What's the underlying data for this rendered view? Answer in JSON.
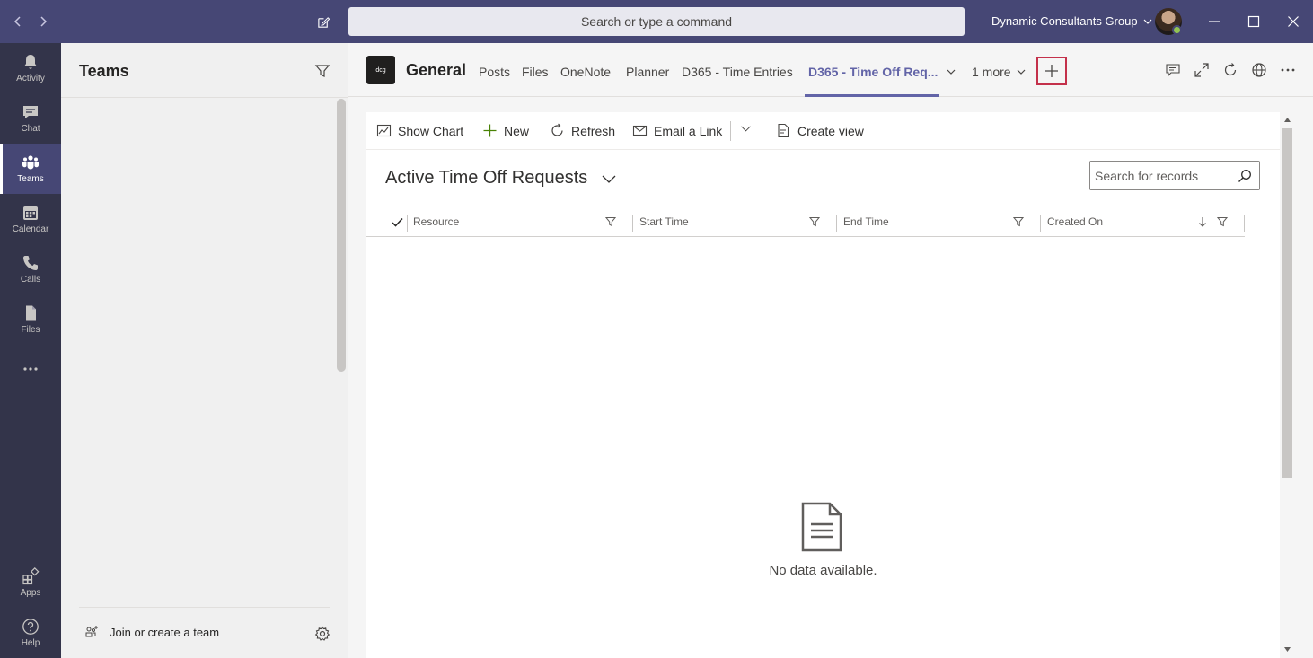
{
  "titlebar": {
    "search_placeholder": "Search or type a command",
    "org_name": "Dynamic Consultants Group"
  },
  "rail": {
    "items": [
      {
        "label": "Activity",
        "icon": "bell-icon"
      },
      {
        "label": "Chat",
        "icon": "chat-icon"
      },
      {
        "label": "Teams",
        "icon": "teams-icon",
        "active": true
      },
      {
        "label": "Calendar",
        "icon": "calendar-icon"
      },
      {
        "label": "Calls",
        "icon": "phone-icon"
      },
      {
        "label": "Files",
        "icon": "file-icon"
      },
      {
        "label": "",
        "icon": "more-icon"
      },
      {
        "label": "Apps",
        "icon": "apps-icon"
      },
      {
        "label": "Help",
        "icon": "help-icon"
      }
    ]
  },
  "teams_panel": {
    "title": "Teams",
    "join_label": "Join or create a team"
  },
  "channel": {
    "logo_text": "dcg",
    "name": "General",
    "tabs": [
      {
        "label": "Posts"
      },
      {
        "label": "Files"
      },
      {
        "label": "OneNote"
      },
      {
        "label": "Planner"
      },
      {
        "label": "D365 - Time Entries"
      },
      {
        "label": "D365 - Time Off Req...",
        "active": true
      },
      {
        "label": "1 more"
      }
    ]
  },
  "commandbar": {
    "show_chart": "Show Chart",
    "new": "New",
    "refresh": "Refresh",
    "email_link": "Email a Link",
    "create_view": "Create view"
  },
  "view": {
    "title": "Active Time Off Requests",
    "search_placeholder": "Search for records"
  },
  "grid": {
    "columns": [
      "Resource",
      "Start Time",
      "End Time",
      "Created On"
    ],
    "empty_text": "No data available."
  },
  "colors": {
    "titlebar": "#464775",
    "rail": "#33344a",
    "accent": "#6264a7",
    "highlight": "#c4314b"
  }
}
